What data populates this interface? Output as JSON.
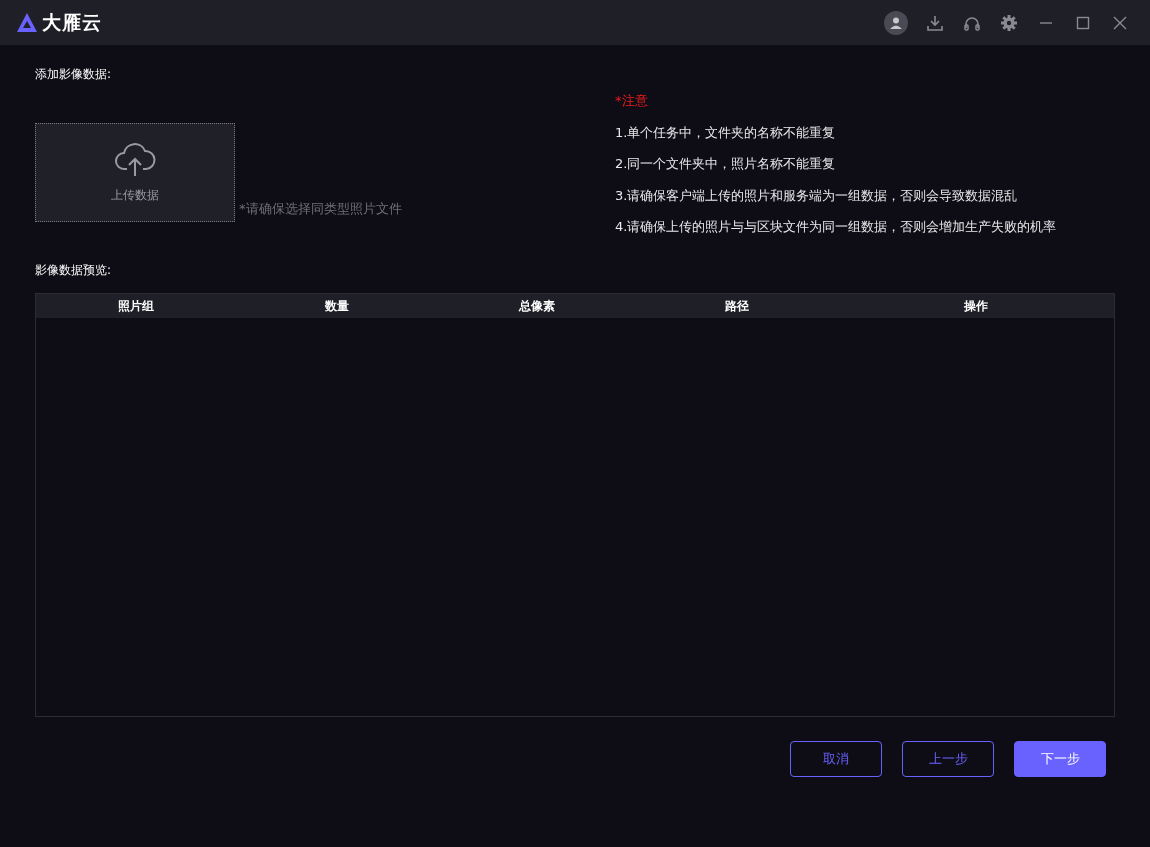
{
  "window": {
    "title": "大雁云"
  },
  "add_section": {
    "label": "添加影像数据:",
    "upload_label": "上传数据",
    "hint": "*请确保选择同类型照片文件"
  },
  "notice": {
    "title": "*注意",
    "items": [
      "1.单个任务中，文件夹的名称不能重复",
      "2.同一个文件夹中，照片名称不能重复",
      "3.请确保客户端上传的照片和服务端为一组数据，否则会导致数据混乱",
      "4.请确保上传的照片与与区块文件为同一组数据，否则会增加生产失败的机率"
    ]
  },
  "preview": {
    "label": "影像数据预览:",
    "columns": [
      "照片组",
      "数量",
      "总像素",
      "路径",
      "操作"
    ]
  },
  "buttons": [
    {
      "label": "取消",
      "kind": "outline"
    },
    {
      "label": "上一步",
      "kind": "outline"
    },
    {
      "label": "下一步",
      "kind": "primary"
    }
  ]
}
